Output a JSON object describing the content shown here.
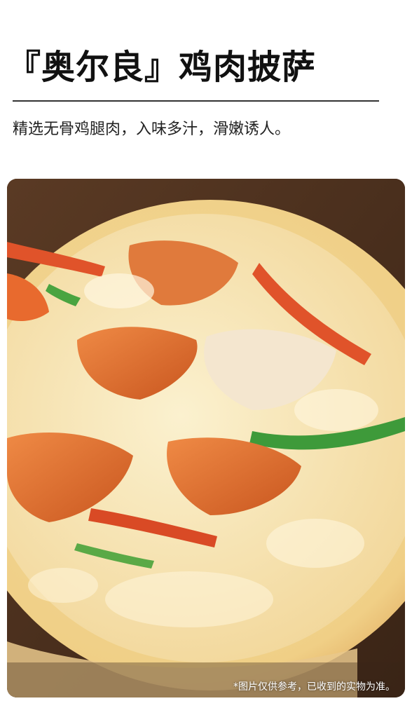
{
  "header": {
    "title": "『奥尔良』鸡肉披萨",
    "subtitle": "精选无骨鸡腿肉，入味多汁，滑嫩诱人。"
  },
  "photo": {
    "disclaimer": "*图片仅供参考，已收到的实物为准。"
  }
}
